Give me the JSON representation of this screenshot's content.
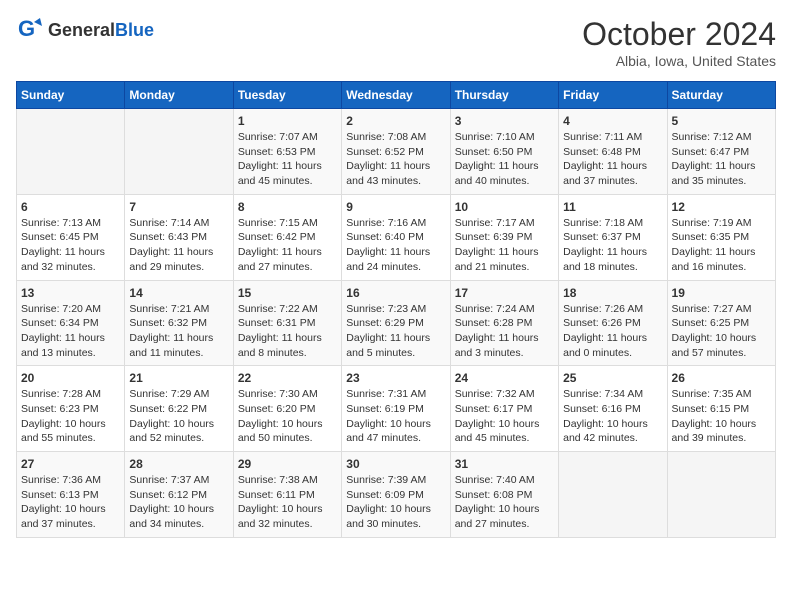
{
  "logo": {
    "general": "General",
    "blue": "Blue"
  },
  "title": "October 2024",
  "subtitle": "Albia, Iowa, United States",
  "weekdays": [
    "Sunday",
    "Monday",
    "Tuesday",
    "Wednesday",
    "Thursday",
    "Friday",
    "Saturday"
  ],
  "weeks": [
    [
      {
        "day": null
      },
      {
        "day": null
      },
      {
        "day": 1,
        "sunrise": "7:07 AM",
        "sunset": "6:53 PM",
        "daylight": "11 hours and 45 minutes."
      },
      {
        "day": 2,
        "sunrise": "7:08 AM",
        "sunset": "6:52 PM",
        "daylight": "11 hours and 43 minutes."
      },
      {
        "day": 3,
        "sunrise": "7:10 AM",
        "sunset": "6:50 PM",
        "daylight": "11 hours and 40 minutes."
      },
      {
        "day": 4,
        "sunrise": "7:11 AM",
        "sunset": "6:48 PM",
        "daylight": "11 hours and 37 minutes."
      },
      {
        "day": 5,
        "sunrise": "7:12 AM",
        "sunset": "6:47 PM",
        "daylight": "11 hours and 35 minutes."
      }
    ],
    [
      {
        "day": 6,
        "sunrise": "7:13 AM",
        "sunset": "6:45 PM",
        "daylight": "11 hours and 32 minutes."
      },
      {
        "day": 7,
        "sunrise": "7:14 AM",
        "sunset": "6:43 PM",
        "daylight": "11 hours and 29 minutes."
      },
      {
        "day": 8,
        "sunrise": "7:15 AM",
        "sunset": "6:42 PM",
        "daylight": "11 hours and 27 minutes."
      },
      {
        "day": 9,
        "sunrise": "7:16 AM",
        "sunset": "6:40 PM",
        "daylight": "11 hours and 24 minutes."
      },
      {
        "day": 10,
        "sunrise": "7:17 AM",
        "sunset": "6:39 PM",
        "daylight": "11 hours and 21 minutes."
      },
      {
        "day": 11,
        "sunrise": "7:18 AM",
        "sunset": "6:37 PM",
        "daylight": "11 hours and 18 minutes."
      },
      {
        "day": 12,
        "sunrise": "7:19 AM",
        "sunset": "6:35 PM",
        "daylight": "11 hours and 16 minutes."
      }
    ],
    [
      {
        "day": 13,
        "sunrise": "7:20 AM",
        "sunset": "6:34 PM",
        "daylight": "11 hours and 13 minutes."
      },
      {
        "day": 14,
        "sunrise": "7:21 AM",
        "sunset": "6:32 PM",
        "daylight": "11 hours and 11 minutes."
      },
      {
        "day": 15,
        "sunrise": "7:22 AM",
        "sunset": "6:31 PM",
        "daylight": "11 hours and 8 minutes."
      },
      {
        "day": 16,
        "sunrise": "7:23 AM",
        "sunset": "6:29 PM",
        "daylight": "11 hours and 5 minutes."
      },
      {
        "day": 17,
        "sunrise": "7:24 AM",
        "sunset": "6:28 PM",
        "daylight": "11 hours and 3 minutes."
      },
      {
        "day": 18,
        "sunrise": "7:26 AM",
        "sunset": "6:26 PM",
        "daylight": "11 hours and 0 minutes."
      },
      {
        "day": 19,
        "sunrise": "7:27 AM",
        "sunset": "6:25 PM",
        "daylight": "10 hours and 57 minutes."
      }
    ],
    [
      {
        "day": 20,
        "sunrise": "7:28 AM",
        "sunset": "6:23 PM",
        "daylight": "10 hours and 55 minutes."
      },
      {
        "day": 21,
        "sunrise": "7:29 AM",
        "sunset": "6:22 PM",
        "daylight": "10 hours and 52 minutes."
      },
      {
        "day": 22,
        "sunrise": "7:30 AM",
        "sunset": "6:20 PM",
        "daylight": "10 hours and 50 minutes."
      },
      {
        "day": 23,
        "sunrise": "7:31 AM",
        "sunset": "6:19 PM",
        "daylight": "10 hours and 47 minutes."
      },
      {
        "day": 24,
        "sunrise": "7:32 AM",
        "sunset": "6:17 PM",
        "daylight": "10 hours and 45 minutes."
      },
      {
        "day": 25,
        "sunrise": "7:34 AM",
        "sunset": "6:16 PM",
        "daylight": "10 hours and 42 minutes."
      },
      {
        "day": 26,
        "sunrise": "7:35 AM",
        "sunset": "6:15 PM",
        "daylight": "10 hours and 39 minutes."
      }
    ],
    [
      {
        "day": 27,
        "sunrise": "7:36 AM",
        "sunset": "6:13 PM",
        "daylight": "10 hours and 37 minutes."
      },
      {
        "day": 28,
        "sunrise": "7:37 AM",
        "sunset": "6:12 PM",
        "daylight": "10 hours and 34 minutes."
      },
      {
        "day": 29,
        "sunrise": "7:38 AM",
        "sunset": "6:11 PM",
        "daylight": "10 hours and 32 minutes."
      },
      {
        "day": 30,
        "sunrise": "7:39 AM",
        "sunset": "6:09 PM",
        "daylight": "10 hours and 30 minutes."
      },
      {
        "day": 31,
        "sunrise": "7:40 AM",
        "sunset": "6:08 PM",
        "daylight": "10 hours and 27 minutes."
      },
      {
        "day": null
      },
      {
        "day": null
      }
    ]
  ]
}
